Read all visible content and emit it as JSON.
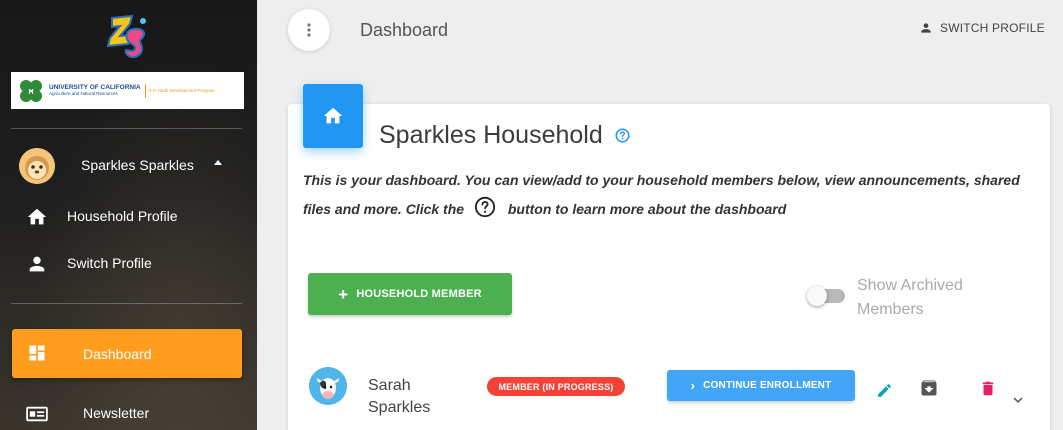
{
  "sidebar": {
    "org": {
      "line1": "UNIVERSITY OF CALIFORNIA",
      "line2": "Agriculture and Natural Resources",
      "line3": "4-H Youth Development Program"
    },
    "user": {
      "name": "Sparkles Sparkles"
    },
    "items": [
      {
        "label": "Household Profile",
        "icon": "home-icon"
      },
      {
        "label": "Switch Profile",
        "icon": "person-icon"
      },
      {
        "label": "Dashboard",
        "icon": "dashboard-icon",
        "active": true
      },
      {
        "label": "Newsletter",
        "icon": "newsletter-icon"
      }
    ]
  },
  "header": {
    "title": "Dashboard",
    "switch_profile": "SWITCH PROFILE"
  },
  "card": {
    "title": "Sparkles Household",
    "desc_part1": "This is your dashboard. You can view/add to your household members below, view announcements, shared files and more. Click the",
    "desc_part2": "button to learn more about the dashboard",
    "add_member": "HOUSEHOLD MEMBER",
    "toggle_label": "Show Archived Members",
    "toggle_on": false
  },
  "members": [
    {
      "name": "Sarah Sparkles",
      "status": "MEMBER (IN PROGRESS)",
      "action": "CONTINUE ENROLLMENT"
    }
  ],
  "colors": {
    "accent_orange": "#ff9d1f",
    "primary_blue": "#2196f3",
    "success_green": "#4caf50",
    "status_red": "#f44336",
    "delete_pink": "#e91e63",
    "edit_teal": "#0aa2c0"
  }
}
